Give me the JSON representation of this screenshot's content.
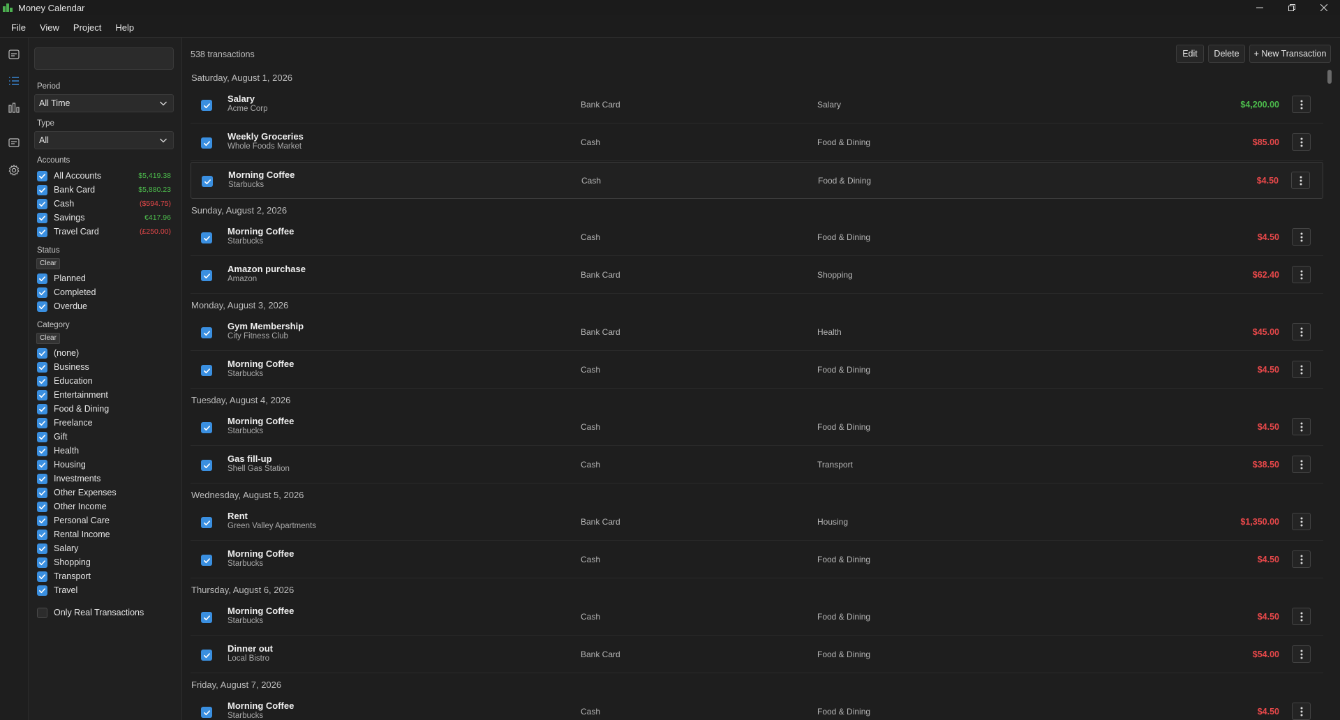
{
  "app": {
    "title": "Money Calendar"
  },
  "menu": [
    "File",
    "View",
    "Project",
    "Help"
  ],
  "sidebar": {
    "search_value": "",
    "period": {
      "label": "Period",
      "value": "All Time"
    },
    "type": {
      "label": "Type",
      "value": "All"
    },
    "accounts_label": "Accounts",
    "accounts": [
      {
        "name": "All Accounts",
        "balance": "$5,419.38",
        "status": "positive"
      },
      {
        "name": "Bank Card",
        "balance": "$5,880.23",
        "status": "positive"
      },
      {
        "name": "Cash",
        "balance": "($594.75)",
        "status": "negative"
      },
      {
        "name": "Savings",
        "balance": "€417.96",
        "status": "positive"
      },
      {
        "name": "Travel Card",
        "balance": "(£250.00)",
        "status": "negative"
      }
    ],
    "status_label": "Status",
    "clear_label": "Clear",
    "statuses": [
      "Planned",
      "Completed",
      "Overdue"
    ],
    "category_label": "Category",
    "categories": [
      "(none)",
      "Business",
      "Education",
      "Entertainment",
      "Food & Dining",
      "Freelance",
      "Gift",
      "Health",
      "Housing",
      "Investments",
      "Other Expenses",
      "Other Income",
      "Personal Care",
      "Rental Income",
      "Salary",
      "Shopping",
      "Transport",
      "Travel"
    ],
    "only_real_label": "Only Real Transactions"
  },
  "toolbar": {
    "count": "538 transactions",
    "edit": "Edit",
    "delete": "Delete",
    "new": "+ New Transaction"
  },
  "days": [
    {
      "date": "Saturday, August 1, 2026",
      "tx": [
        {
          "name": "Salary",
          "payee": "Acme Corp",
          "account": "Bank Card",
          "category": "Salary",
          "amount": "$4,200.00",
          "kind": "income"
        },
        {
          "name": "Weekly Groceries",
          "payee": "Whole Foods Market",
          "account": "Cash",
          "category": "Food & Dining",
          "amount": "$85.00",
          "kind": "expense"
        },
        {
          "name": "Morning Coffee",
          "payee": "Starbucks",
          "account": "Cash",
          "category": "Food & Dining",
          "amount": "$4.50",
          "kind": "expense",
          "selected": true
        }
      ]
    },
    {
      "date": "Sunday, August 2, 2026",
      "tx": [
        {
          "name": "Morning Coffee",
          "payee": "Starbucks",
          "account": "Cash",
          "category": "Food & Dining",
          "amount": "$4.50",
          "kind": "expense"
        },
        {
          "name": "Amazon purchase",
          "payee": "Amazon",
          "account": "Bank Card",
          "category": "Shopping",
          "amount": "$62.40",
          "kind": "expense"
        }
      ]
    },
    {
      "date": "Monday, August 3, 2026",
      "tx": [
        {
          "name": "Gym Membership",
          "payee": "City Fitness Club",
          "account": "Bank Card",
          "category": "Health",
          "amount": "$45.00",
          "kind": "expense"
        },
        {
          "name": "Morning Coffee",
          "payee": "Starbucks",
          "account": "Cash",
          "category": "Food & Dining",
          "amount": "$4.50",
          "kind": "expense"
        }
      ]
    },
    {
      "date": "Tuesday, August 4, 2026",
      "tx": [
        {
          "name": "Morning Coffee",
          "payee": "Starbucks",
          "account": "Cash",
          "category": "Food & Dining",
          "amount": "$4.50",
          "kind": "expense"
        },
        {
          "name": "Gas fill-up",
          "payee": "Shell Gas Station",
          "account": "Cash",
          "category": "Transport",
          "amount": "$38.50",
          "kind": "expense"
        }
      ]
    },
    {
      "date": "Wednesday, August 5, 2026",
      "tx": [
        {
          "name": "Rent",
          "payee": "Green Valley Apartments",
          "account": "Bank Card",
          "category": "Housing",
          "amount": "$1,350.00",
          "kind": "expense"
        },
        {
          "name": "Morning Coffee",
          "payee": "Starbucks",
          "account": "Cash",
          "category": "Food & Dining",
          "amount": "$4.50",
          "kind": "expense"
        }
      ]
    },
    {
      "date": "Thursday, August 6, 2026",
      "tx": [
        {
          "name": "Morning Coffee",
          "payee": "Starbucks",
          "account": "Cash",
          "category": "Food & Dining",
          "amount": "$4.50",
          "kind": "expense"
        },
        {
          "name": "Dinner out",
          "payee": "Local Bistro",
          "account": "Bank Card",
          "category": "Food & Dining",
          "amount": "$54.00",
          "kind": "expense"
        }
      ]
    },
    {
      "date": "Friday, August 7, 2026",
      "tx": [
        {
          "name": "Morning Coffee",
          "payee": "Starbucks",
          "account": "Cash",
          "category": "Food & Dining",
          "amount": "$4.50",
          "kind": "expense"
        }
      ]
    }
  ],
  "colors": {
    "accent": "#3a8fe0",
    "income": "#4cbb4c",
    "expense": "#e8484a",
    "background": "#1c1c1c"
  },
  "icons": [
    "calendar-icon",
    "list-icon",
    "chart-icon",
    "notes-icon",
    "gear-icon",
    "minimize-icon",
    "restore-icon",
    "close-icon",
    "chevron-down-icon",
    "more-vertical-icon",
    "check-icon"
  ]
}
